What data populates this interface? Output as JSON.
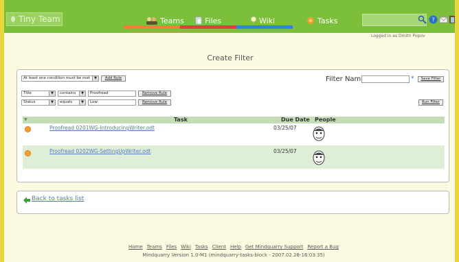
{
  "header": {
    "logo_text": "Tiny Team",
    "nav": [
      {
        "label": "Teams",
        "color": "#e8823a"
      },
      {
        "label": "Files",
        "color": "#e0403a"
      },
      {
        "label": "Wiki",
        "color": "#2f86d6"
      },
      {
        "label": "Tasks",
        "color": "#7bbf3a"
      }
    ],
    "login_text": "Logged in as Dmitri Popov"
  },
  "page_title": "Create Filter",
  "filter": {
    "condition_mode": "At least one condition must be met",
    "add_rule_label": "Add Rule",
    "filter_name_label": "Filter Name",
    "filter_name_value": "",
    "required_mark": "*",
    "save_filter_label": "Save Filter",
    "run_filter_label": "Run Filter",
    "rules": [
      {
        "field": "Title",
        "op": "contains",
        "value": "Proofread",
        "remove_label": "Remove Rule"
      },
      {
        "field": "Status",
        "op": "equals",
        "value": "Low",
        "remove_label": "Remove Rule"
      }
    ]
  },
  "table": {
    "columns": [
      "Task",
      "Due Date",
      "People"
    ],
    "rows": [
      {
        "task": "Proofread 0201WG-IntroducingWriter.odt",
        "due": "03/25/07"
      },
      {
        "task": "Proofread 0202WG-SettingUpWriter.odt",
        "due": "03/25/07"
      }
    ]
  },
  "back_link": "Back to tasks list",
  "footer": {
    "links": [
      "Home",
      "Teams",
      "Files",
      "Wiki",
      "Tasks",
      "Client",
      "Help",
      "Get Mindquarry Support",
      "Report a Bug"
    ],
    "version": "Mindquarry Version 1.0-M1 (mindquarry-tasks-block - 2007.02.28-16:03:35)"
  }
}
